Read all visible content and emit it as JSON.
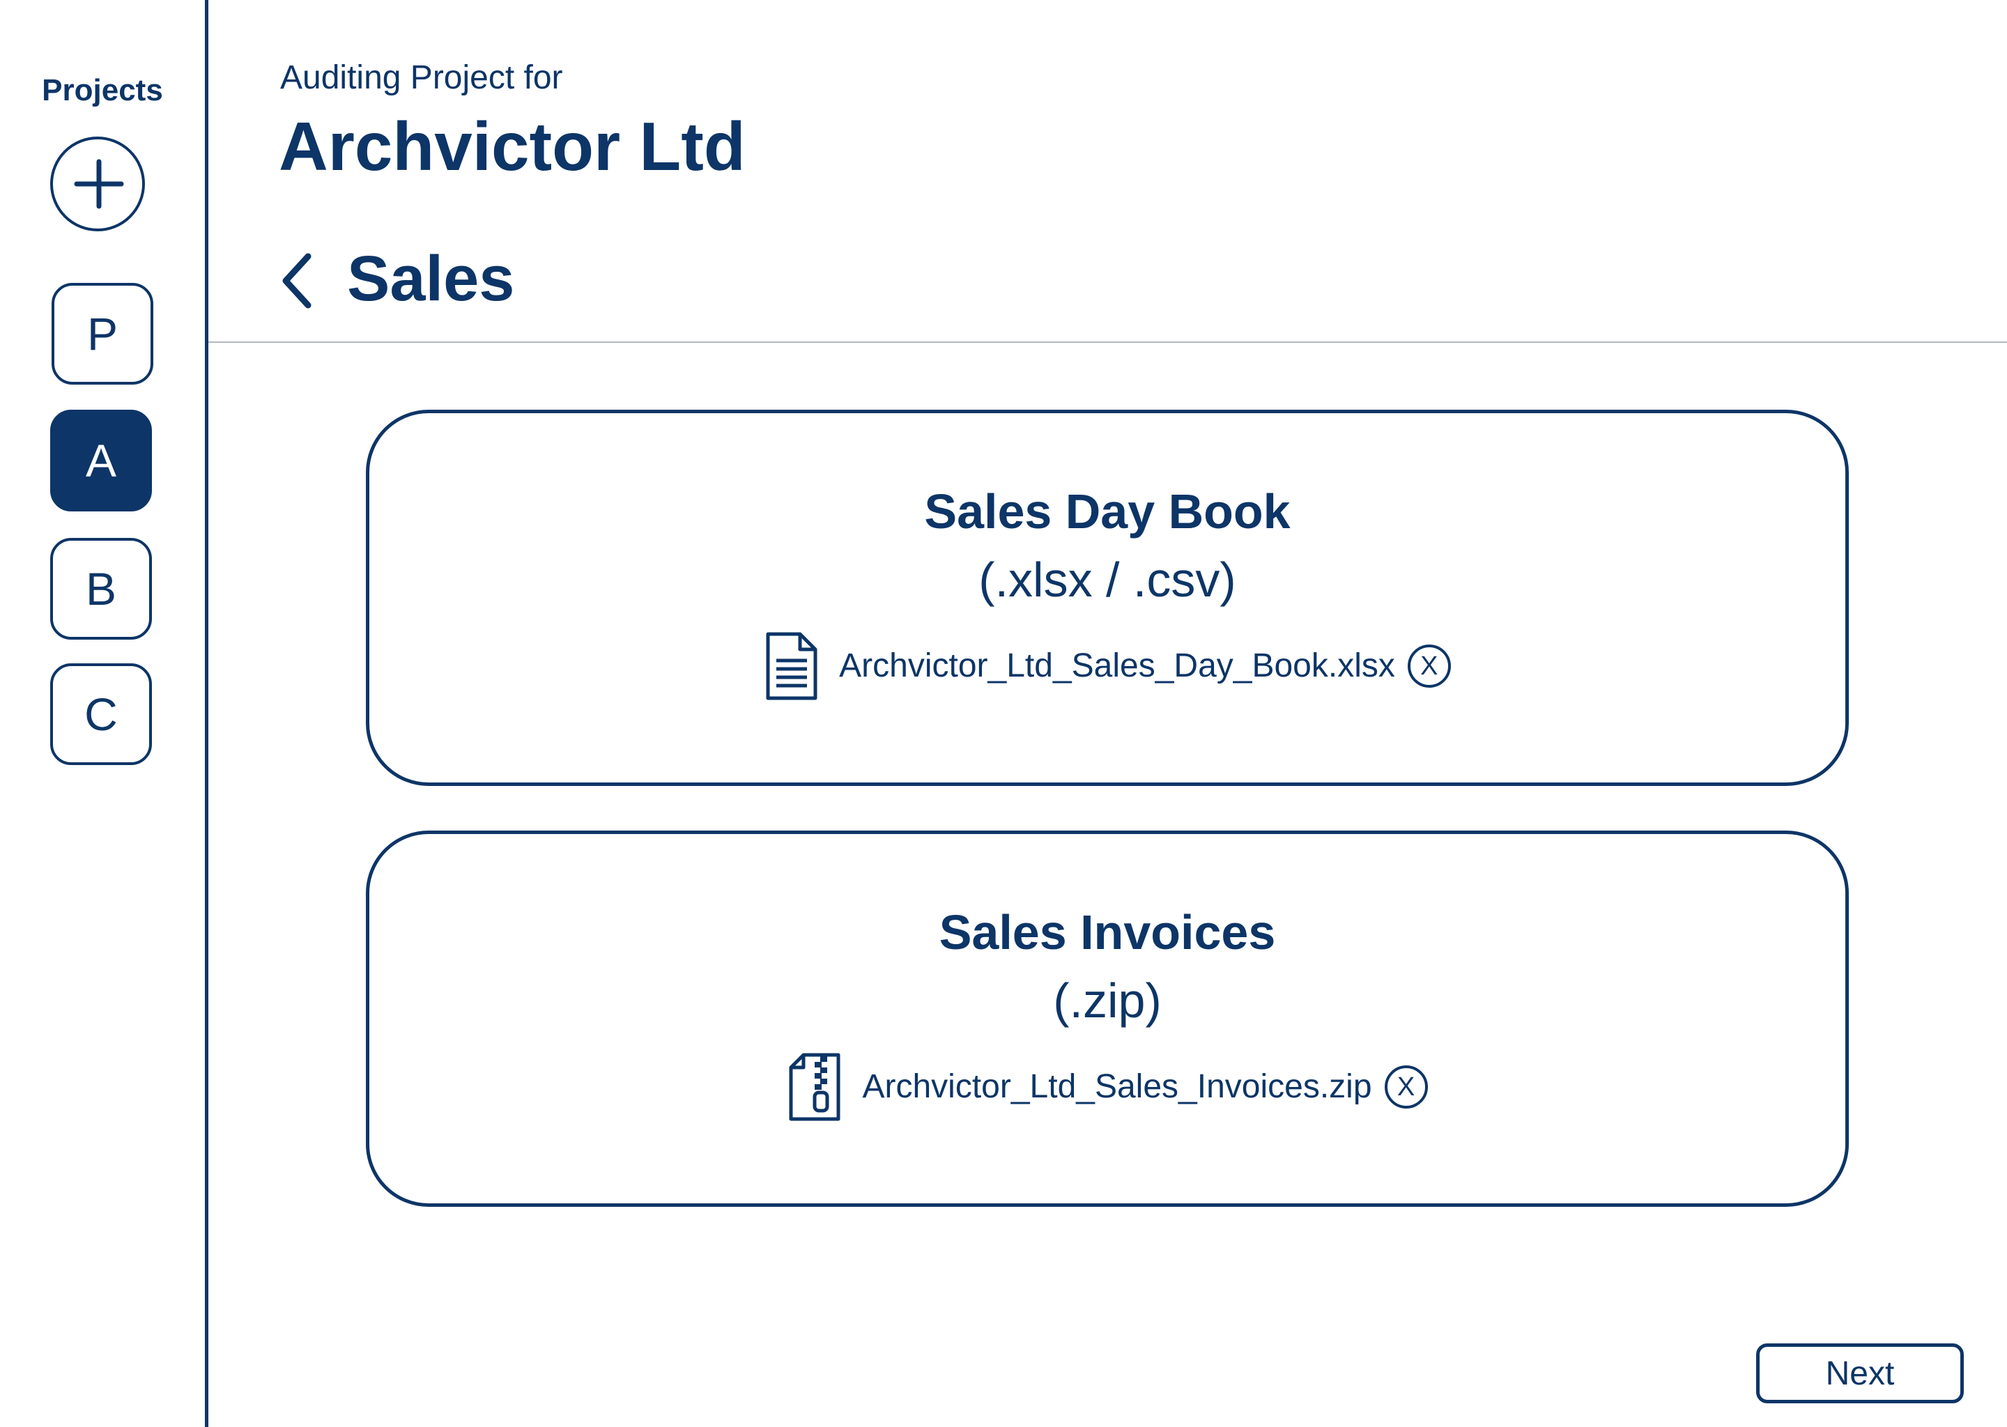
{
  "sidebar": {
    "title": "Projects",
    "projects": [
      {
        "letter": "P",
        "active": false
      },
      {
        "letter": "A",
        "active": true
      },
      {
        "letter": "B",
        "active": false
      },
      {
        "letter": "C",
        "active": false
      }
    ]
  },
  "header": {
    "subtitle": "Auditing Project for",
    "title": "Archvictor Ltd",
    "section": "Sales"
  },
  "cards": [
    {
      "title": "Sales Day Book",
      "format": "(.xlsx / .csv)",
      "file_icon": "document-icon",
      "file_name": "Archvictor_Ltd_Sales_Day_Book.xlsx",
      "remove_label": "X"
    },
    {
      "title": "Sales Invoices",
      "format": "(.zip)",
      "file_icon": "zip-file-icon",
      "file_name": "Archvictor_Ltd_Sales_Invoices.zip",
      "remove_label": "X"
    }
  ],
  "footer": {
    "next_label": "Next"
  },
  "colors": {
    "primary": "#0d3567",
    "divider": "#b4b8bf",
    "background": "#ffffff"
  }
}
